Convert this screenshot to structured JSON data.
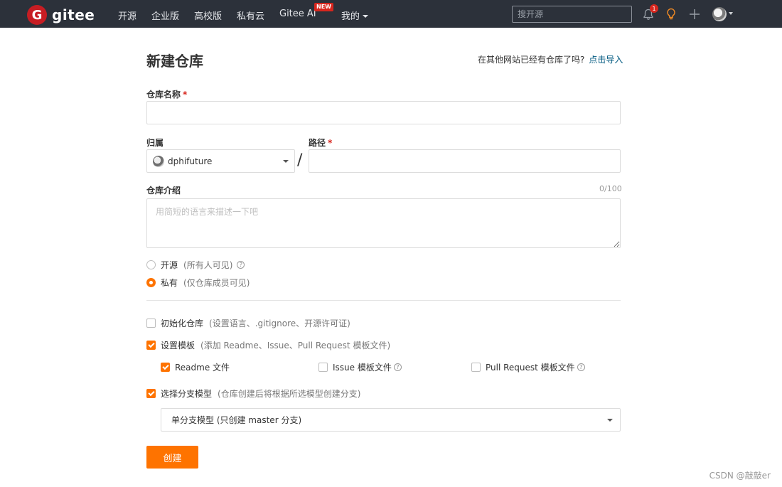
{
  "nav": {
    "logo_mark": "G",
    "logo_text": "gitee",
    "items": [
      "开源",
      "企业版",
      "高校版",
      "私有云",
      "Gitee AI",
      "我的"
    ],
    "ai_badge": "NEW",
    "search_placeholder": "搜开源",
    "notification_count": "1",
    "icons": [
      "bell-icon",
      "lightbulb-icon",
      "plus-icon",
      "avatar"
    ]
  },
  "header": {
    "title": "新建仓库",
    "import_hint": "在其他网站已经有仓库了吗?",
    "import_link": "点击导入"
  },
  "form": {
    "name_label": "仓库名称",
    "required_mark": "*",
    "owner_label": "归属",
    "owner_value": "dphifuture",
    "path_label": "路径",
    "path_separator": "/",
    "desc_label": "仓库介绍",
    "desc_counter": "0/100",
    "desc_placeholder": "用简短的语言来描述一下吧",
    "visibility": [
      {
        "label": "开源",
        "note": "(所有人可见)",
        "checked": false,
        "help": true
      },
      {
        "label": "私有",
        "note": "(仅仓库成员可见)",
        "checked": true,
        "help": false
      }
    ],
    "init_repo": {
      "label": "初始化仓库",
      "note": "(设置语言、.gitignore、开源许可证)",
      "checked": false
    },
    "template": {
      "label": "设置模板",
      "note": "(添加 Readme、Issue、Pull Request 模板文件)",
      "checked": true
    },
    "templates": [
      {
        "label": "Readme 文件",
        "checked": true,
        "help": false
      },
      {
        "label": "Issue 模板文件",
        "checked": false,
        "help": true
      },
      {
        "label": "Pull Request 模板文件",
        "checked": false,
        "help": true
      }
    ],
    "branch_model": {
      "label": "选择分支模型",
      "note": "(仓库创建后将根据所选模型创建分支)",
      "checked": true
    },
    "branch_select_value": "单分支模型 (只创建 master 分支)",
    "submit_label": "创建"
  },
  "watermark": "CSDN @敲敲er",
  "colors": {
    "accent": "#fe7300",
    "nav_bg": "#2c313a",
    "brand": "#c71d23",
    "link": "#005980"
  }
}
